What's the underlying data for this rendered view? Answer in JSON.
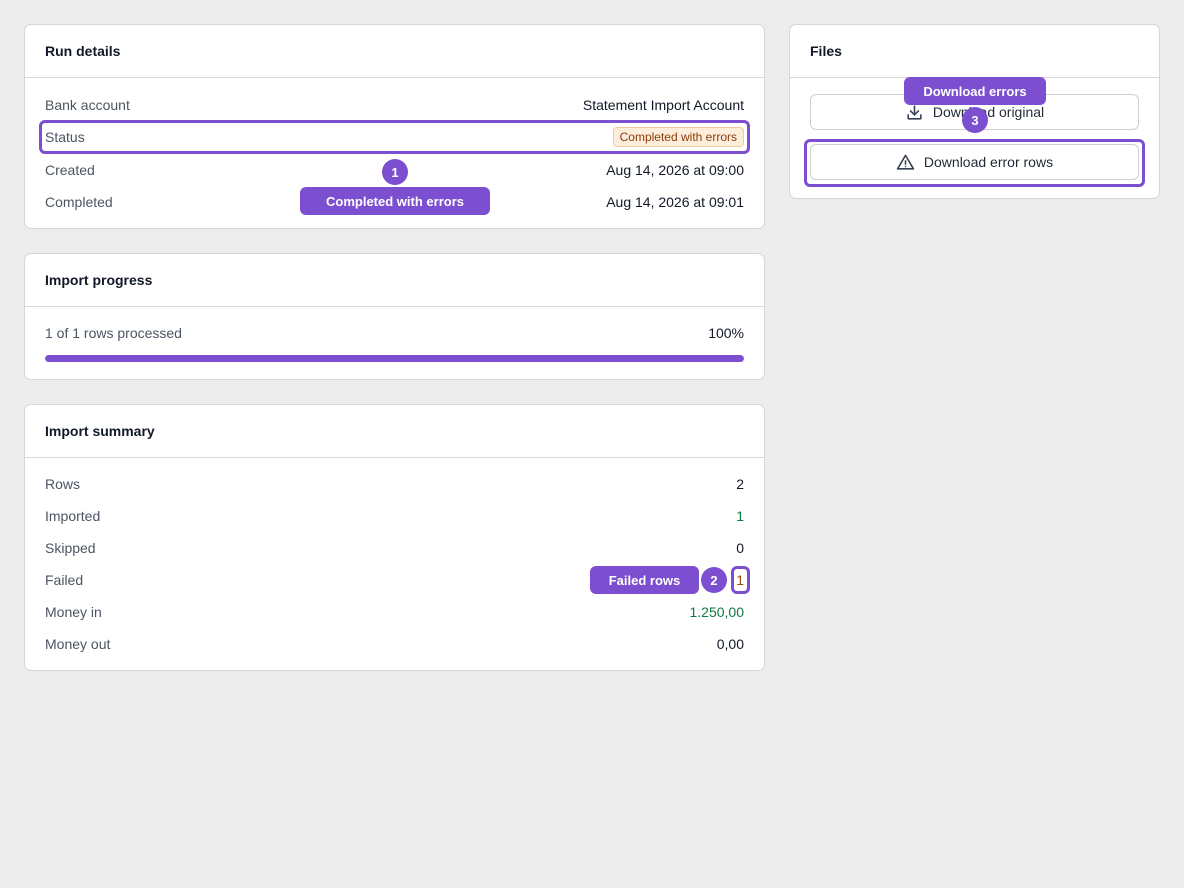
{
  "run_details": {
    "title": "Run details",
    "rows": [
      {
        "label": "Bank account",
        "value": "Statement Import Account"
      },
      {
        "label": "Status",
        "value": "Completed with errors"
      },
      {
        "label": "Created",
        "value": "Aug 14, 2026 at 09:00"
      },
      {
        "label": "Completed",
        "value": "Aug 14, 2026 at 09:01"
      }
    ]
  },
  "import_progress": {
    "title": "Import progress",
    "processed_text": "1 of 1 rows processed",
    "percent_text": "100%",
    "progress_fraction": 1.0
  },
  "import_summary": {
    "title": "Import summary",
    "rows": [
      {
        "label": "Rows",
        "value": "2"
      },
      {
        "label": "Imported",
        "value": "1"
      },
      {
        "label": "Skipped",
        "value": "0"
      },
      {
        "label": "Failed",
        "value": "1"
      },
      {
        "label": "Money in",
        "value": "1.250,00"
      },
      {
        "label": "Money out",
        "value": "0,00"
      }
    ]
  },
  "files": {
    "title": "Files",
    "download_original_label": "Download original",
    "download_error_rows_label": "Download error rows",
    "download_original_icon": "download-icon",
    "download_error_rows_icon": "warning-triangle-icon"
  },
  "annotations": [
    {
      "number": "1",
      "label": "Completed with errors"
    },
    {
      "number": "2",
      "label": "Failed rows"
    },
    {
      "number": "3",
      "label": "Download errors"
    }
  ],
  "colors": {
    "accent": "#7b4fcf",
    "positive": "#0f7a43",
    "warning_badge_bg": "#fdeedc",
    "warning_text": "#8a3b0a"
  }
}
